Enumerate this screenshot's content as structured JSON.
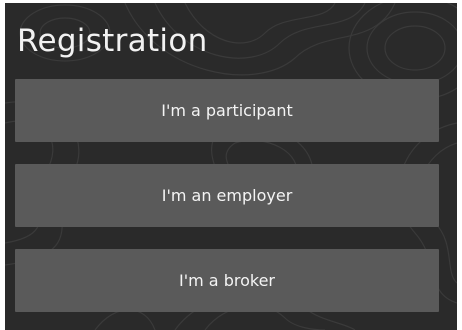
{
  "page": {
    "title": "Registration"
  },
  "buttons": [
    {
      "label": "I'm a participant"
    },
    {
      "label": "I'm an employer"
    },
    {
      "label": "I'm a broker"
    }
  ],
  "colors": {
    "panel_background": "#2a2a2a",
    "button_background": "#5a5a5a",
    "text": "#f2f2f2"
  }
}
